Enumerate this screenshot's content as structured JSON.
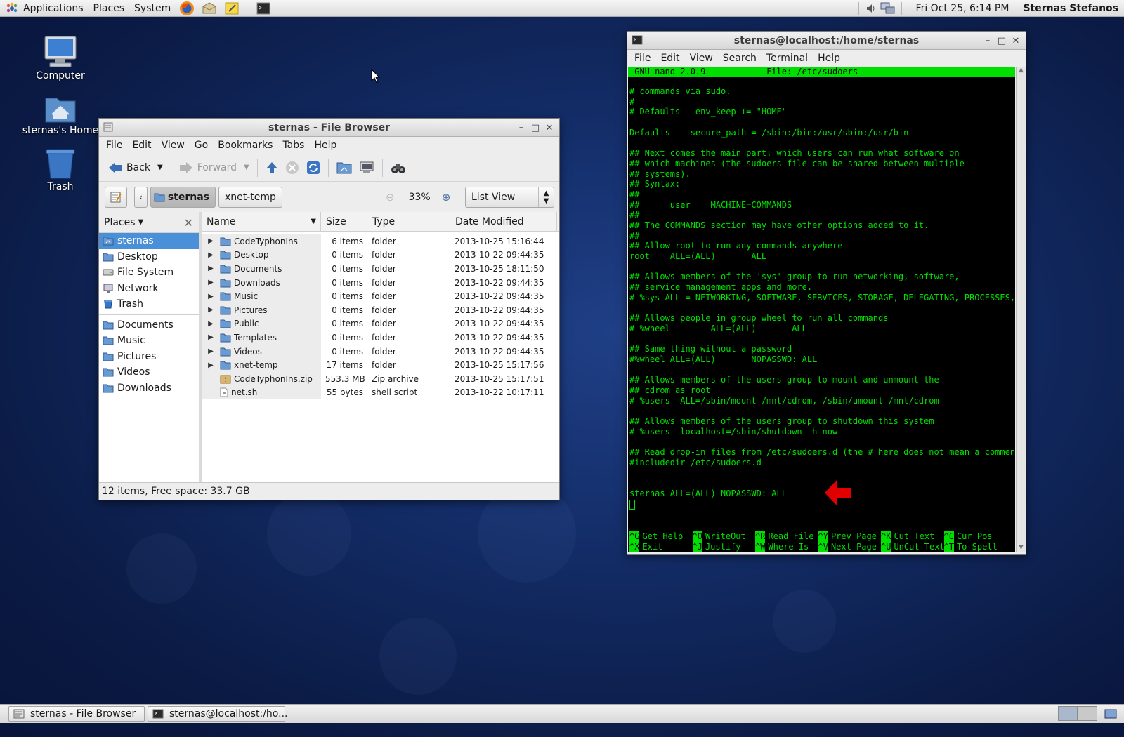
{
  "top_panel": {
    "menus": [
      "Applications",
      "Places",
      "System"
    ],
    "launchers": [
      "firefox-icon",
      "mail-icon",
      "notes-icon",
      "terminal-icon"
    ],
    "clock": "Fri Oct 25,  6:14 PM",
    "user": "Sternas Stefanos"
  },
  "desktop_icons": [
    {
      "name": "computer",
      "label": "Computer"
    },
    {
      "name": "home",
      "label": "sternas's Home"
    },
    {
      "name": "trash",
      "label": "Trash"
    }
  ],
  "file_browser": {
    "title": "sternas - File Browser",
    "menus": [
      "File",
      "Edit",
      "View",
      "Go",
      "Bookmarks",
      "Tabs",
      "Help"
    ],
    "toolbar": {
      "back": "Back",
      "forward": "Forward"
    },
    "path": {
      "current": "sternas",
      "next": "xnet-temp"
    },
    "zoom": "33%",
    "view_mode": "List View",
    "sidebar": {
      "header": "Places",
      "group1": [
        {
          "label": "sternas",
          "icon": "home-folder-icon",
          "selected": true
        },
        {
          "label": "Desktop",
          "icon": "folder-icon"
        },
        {
          "label": "File System",
          "icon": "drive-icon"
        },
        {
          "label": "Network",
          "icon": "network-icon"
        },
        {
          "label": "Trash",
          "icon": "trash-icon"
        }
      ],
      "group2": [
        {
          "label": "Documents",
          "icon": "folder-icon"
        },
        {
          "label": "Music",
          "icon": "folder-icon"
        },
        {
          "label": "Pictures",
          "icon": "folder-icon"
        },
        {
          "label": "Videos",
          "icon": "folder-icon"
        },
        {
          "label": "Downloads",
          "icon": "folder-icon"
        }
      ]
    },
    "columns": [
      "Name",
      "Size",
      "Type",
      "Date Modified"
    ],
    "rows": [
      {
        "name": "CodeTyphonIns",
        "size": "6 items",
        "type": "folder",
        "date": "2013-10-25 15:16:44",
        "kind": "folder"
      },
      {
        "name": "Desktop",
        "size": "0 items",
        "type": "folder",
        "date": "2013-10-22 09:44:35",
        "kind": "folder"
      },
      {
        "name": "Documents",
        "size": "0 items",
        "type": "folder",
        "date": "2013-10-25 18:11:50",
        "kind": "folder"
      },
      {
        "name": "Downloads",
        "size": "0 items",
        "type": "folder",
        "date": "2013-10-22 09:44:35",
        "kind": "folder"
      },
      {
        "name": "Music",
        "size": "0 items",
        "type": "folder",
        "date": "2013-10-22 09:44:35",
        "kind": "folder"
      },
      {
        "name": "Pictures",
        "size": "0 items",
        "type": "folder",
        "date": "2013-10-22 09:44:35",
        "kind": "folder"
      },
      {
        "name": "Public",
        "size": "0 items",
        "type": "folder",
        "date": "2013-10-22 09:44:35",
        "kind": "folder"
      },
      {
        "name": "Templates",
        "size": "0 items",
        "type": "folder",
        "date": "2013-10-22 09:44:35",
        "kind": "folder"
      },
      {
        "name": "Videos",
        "size": "0 items",
        "type": "folder",
        "date": "2013-10-22 09:44:35",
        "kind": "folder"
      },
      {
        "name": "xnet-temp",
        "size": "17 items",
        "type": "folder",
        "date": "2013-10-25 15:17:56",
        "kind": "folder"
      },
      {
        "name": "CodeTyphonIns.zip",
        "size": "553.3 MB",
        "type": "Zip archive",
        "date": "2013-10-25 15:17:51",
        "kind": "zip"
      },
      {
        "name": "net.sh",
        "size": "55 bytes",
        "type": "shell script",
        "date": "2013-10-22 10:17:11",
        "kind": "script"
      }
    ],
    "status": "12 items, Free space: 33.7 GB"
  },
  "terminal": {
    "title": "sternas@localhost:/home/sternas",
    "menus": [
      "File",
      "Edit",
      "View",
      "Search",
      "Terminal",
      "Help"
    ],
    "nano_header": " GNU nano 2.0.9            File: /etc/sudoers",
    "lines": [
      "# commands via sudo.",
      "#",
      "# Defaults   env_keep += \"HOME\"",
      "",
      "Defaults    secure_path = /sbin:/bin:/usr/sbin:/usr/bin",
      "",
      "## Next comes the main part: which users can run what software on",
      "## which machines (the sudoers file can be shared between multiple",
      "## systems).",
      "## Syntax:",
      "##",
      "##      user    MACHINE=COMMANDS",
      "##",
      "## The COMMANDS section may have other options added to it.",
      "##",
      "## Allow root to run any commands anywhere",
      "root    ALL=(ALL)       ALL",
      "",
      "## Allows members of the 'sys' group to run networking, software,",
      "## service management apps and more.",
      "# %sys ALL = NETWORKING, SOFTWARE, SERVICES, STORAGE, DELEGATING, PROCESSES, LOS",
      "",
      "## Allows people in group wheel to run all commands",
      "# %wheel        ALL=(ALL)       ALL",
      "",
      "## Same thing without a password",
      "#%wheel ALL=(ALL)       NOPASSWD: ALL",
      "",
      "## Allows members of the users group to mount and unmount the",
      "## cdrom as root",
      "# %users  ALL=/sbin/mount /mnt/cdrom, /sbin/umount /mnt/cdrom",
      "",
      "## Allows members of the users group to shutdown this system",
      "# %users  localhost=/sbin/shutdown -h now",
      "",
      "## Read drop-in files from /etc/sudoers.d (the # here does not mean a comment)",
      "#includedir /etc/sudoers.d",
      "",
      "",
      "sternas ALL=(ALL) NOPASSWD: ALL"
    ],
    "shortcuts_row1": [
      {
        "key": "^G",
        "label": "Get Help"
      },
      {
        "key": "^O",
        "label": "WriteOut"
      },
      {
        "key": "^R",
        "label": "Read File"
      },
      {
        "key": "^Y",
        "label": "Prev Page"
      },
      {
        "key": "^K",
        "label": "Cut Text"
      },
      {
        "key": "^C",
        "label": "Cur Pos"
      }
    ],
    "shortcuts_row2": [
      {
        "key": "^X",
        "label": "Exit"
      },
      {
        "key": "^J",
        "label": "Justify"
      },
      {
        "key": "^W",
        "label": "Where Is"
      },
      {
        "key": "^V",
        "label": "Next Page"
      },
      {
        "key": "^U",
        "label": "UnCut Text"
      },
      {
        "key": "^T",
        "label": "To Spell"
      }
    ]
  },
  "taskbar": [
    {
      "label": "sternas - File Browser",
      "icon": "file-manager-icon"
    },
    {
      "label": "sternas@localhost:/ho...",
      "icon": "terminal-icon"
    }
  ],
  "colors": {
    "terminal_text": "#00e000",
    "selection": "#4a90d9",
    "arrow": "#e00000"
  }
}
